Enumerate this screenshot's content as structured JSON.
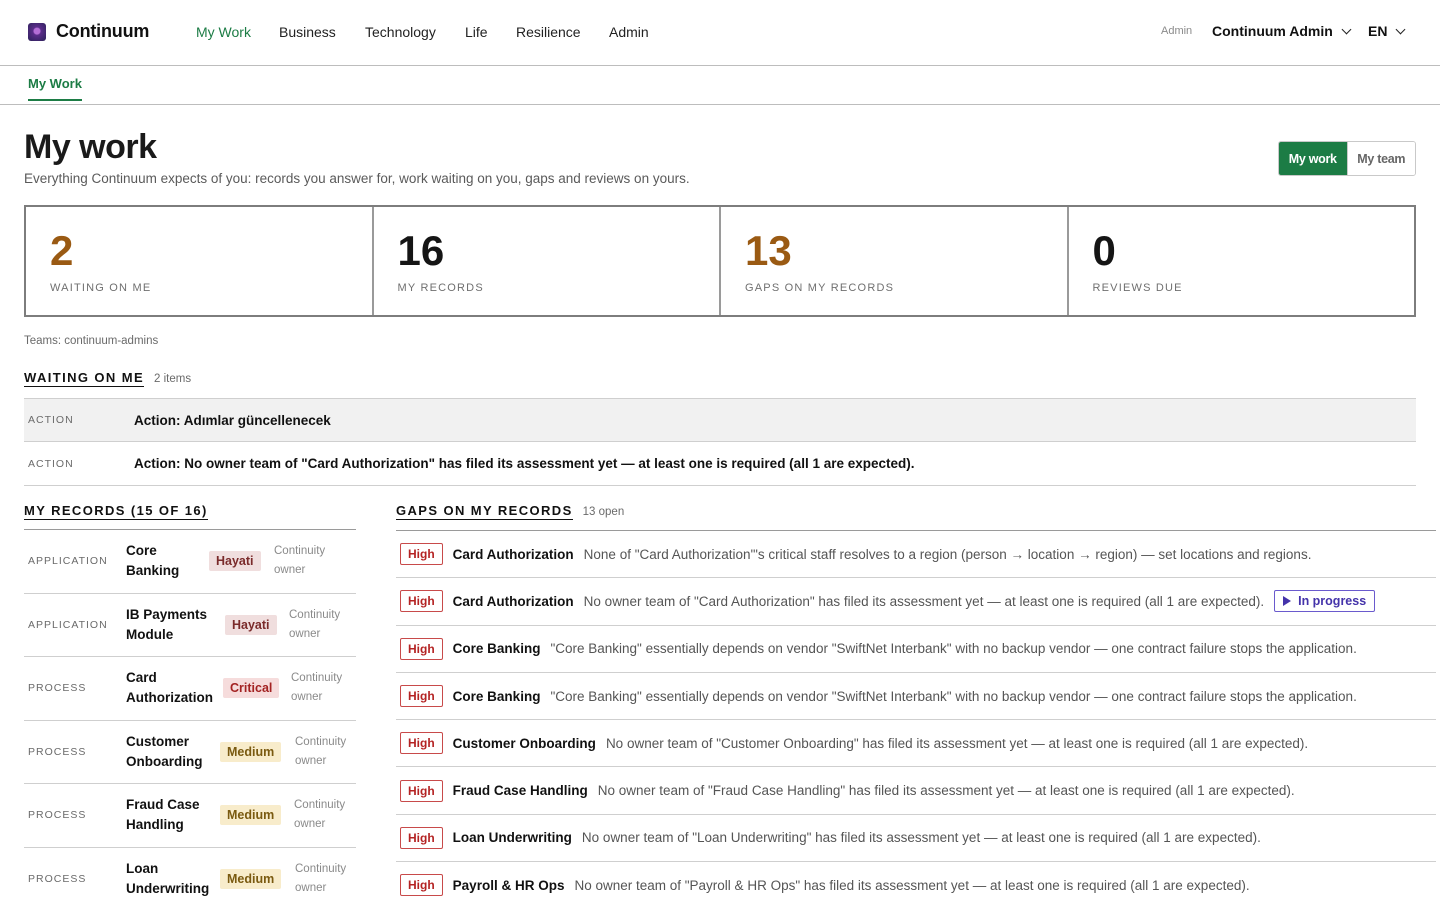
{
  "brand": {
    "name": "Continuum"
  },
  "nav": {
    "items": [
      "My Work",
      "Business",
      "Technology",
      "Life",
      "Resilience",
      "Admin"
    ],
    "user_role": "Admin",
    "user_name": "Continuum Admin",
    "language": "EN"
  },
  "subnav": {
    "tab": "My Work"
  },
  "header": {
    "title": "My work",
    "subtitle": "Everything Continuum expects of you: records you answer for, work waiting on you, gaps and reviews on yours.",
    "toggle": {
      "mine": "My work",
      "team": "My team"
    }
  },
  "stats": [
    {
      "value": "2",
      "label": "WAITING ON ME"
    },
    {
      "value": "16",
      "label": "MY RECORDS"
    },
    {
      "value": "13",
      "label": "GAPS ON MY RECORDS"
    },
    {
      "value": "0",
      "label": "REVIEWS DUE"
    }
  ],
  "teams_line": "Teams: continuum-admins",
  "waiting": {
    "title": "WAITING ON ME",
    "count": "2 items",
    "items": [
      {
        "kind": "ACTION",
        "text": "Action: Adımlar güncellenecek"
      },
      {
        "kind": "ACTION",
        "text": "Action: No owner team of \"Card Authorization\" has filed its assessment yet — at least one is required (all 1 are expected)."
      }
    ]
  },
  "records": {
    "title": "MY RECORDS (15 OF 16)",
    "items": [
      {
        "kind": "APPLICATION",
        "name_1": "Core",
        "name_2": "Banking",
        "badge": "Hayati",
        "owner_1": "Continuity",
        "owner_2": "owner"
      },
      {
        "kind": "APPLICATION",
        "name_1": "IB Payments",
        "name_2": "Module",
        "badge": "Hayati",
        "owner_1": "Continuity",
        "owner_2": "owner"
      },
      {
        "kind": "PROCESS",
        "name_1": "Card",
        "name_2": "Authorization",
        "badge": "Critical",
        "owner_1": "Continuity",
        "owner_2": "owner"
      },
      {
        "kind": "PROCESS",
        "name_1": "Customer",
        "name_2": "Onboarding",
        "badge": "Medium",
        "owner_1": "Continuity",
        "owner_2": "owner"
      },
      {
        "kind": "PROCESS",
        "name_1": "Fraud Case",
        "name_2": "Handling",
        "badge": "Medium",
        "owner_1": "Continuity",
        "owner_2": "owner"
      },
      {
        "kind": "PROCESS",
        "name_1": "Loan",
        "name_2": "Underwriting",
        "badge": "Medium",
        "owner_1": "Continuity",
        "owner_2": "owner"
      }
    ]
  },
  "gaps": {
    "title": "GAPS ON MY RECORDS",
    "count": "13 open",
    "items": [
      {
        "severity": "High",
        "name": "Card Authorization",
        "text": "None of \"Card Authorization\"'s critical staff resolves to a region (person → location → region) — set locations and regions."
      },
      {
        "severity": "High",
        "name": "Card Authorization",
        "text": "No owner team of \"Card Authorization\" has filed its assessment yet — at least one is required (all 1 are expected).",
        "status": "In progress"
      },
      {
        "severity": "High",
        "name": "Core Banking",
        "text": "\"Core Banking\" essentially depends on vendor \"SwiftNet Interbank\" with no backup vendor — one contract failure stops the application."
      },
      {
        "severity": "High",
        "name": "Core Banking",
        "text": "\"Core Banking\" essentially depends on vendor \"SwiftNet Interbank\" with no backup vendor — one contract failure stops the application."
      },
      {
        "severity": "High",
        "name": "Customer Onboarding",
        "text": "No owner team of \"Customer Onboarding\" has filed its assessment yet — at least one is required (all 1 are expected)."
      },
      {
        "severity": "High",
        "name": "Fraud Case Handling",
        "text": "No owner team of \"Fraud Case Handling\" has filed its assessment yet — at least one is required (all 1 are expected)."
      },
      {
        "severity": "High",
        "name": "Loan Underwriting",
        "text": "No owner team of \"Loan Underwriting\" has filed its assessment yet — at least one is required (all 1 are expected)."
      },
      {
        "severity": "High",
        "name": "Payroll & HR Ops",
        "text": "No owner team of \"Payroll & HR Ops\" has filed its assessment yet — at least one is required (all 1 are expected)."
      }
    ]
  },
  "colors": {
    "accent": "#1c7c45",
    "amber": "#9a5a13",
    "severity_high": "#b42323",
    "in_progress": "#4433aa"
  }
}
